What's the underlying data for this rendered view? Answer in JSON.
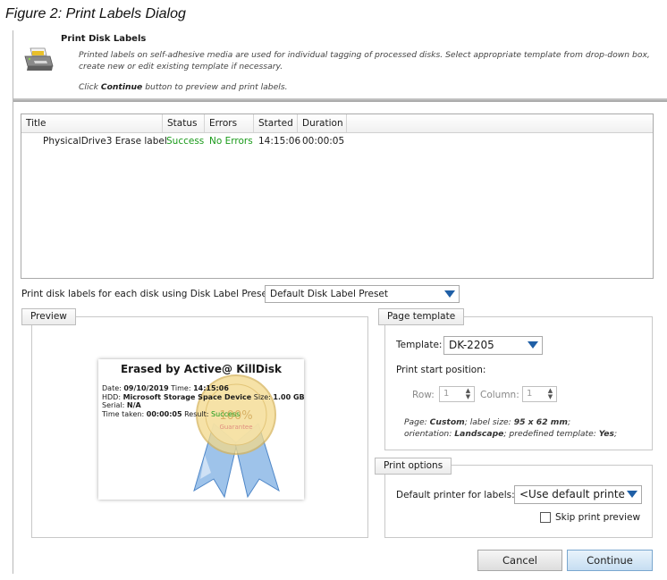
{
  "caption": "Figure 2: Print Labels Dialog",
  "header": {
    "title": "Print Disk Labels",
    "description": "Printed labels on self-adhesive media are used for individual tagging of processed disks. Select appropriate template from drop-down box, create new or edit existing template if necessary.",
    "click_prefix": "Click ",
    "click_bold": "Continue",
    "click_suffix": " button to preview and print labels.",
    "icon": "printer-icon"
  },
  "jobs_table": {
    "columns": [
      "Title",
      "Status",
      "Errors",
      "Started",
      "Duration"
    ],
    "rows": [
      {
        "title": "PhysicalDrive3 Erase label",
        "status": "Success",
        "errors": "No Errors",
        "started": "14:15:06",
        "duration": "00:00:05"
      }
    ],
    "success_color": "#1a9a1a"
  },
  "preset": {
    "label": "Print disk labels for each disk using Disk Label Preset:",
    "value": "Default Disk Label Preset"
  },
  "preview": {
    "tab_label": "Preview",
    "label": {
      "title": "Erased by Active@ KillDisk",
      "date_label": "Date: ",
      "date": "09/10/2019",
      "time_label": " Time: ",
      "time": "14:15:06",
      "hdd_label": "HDD: ",
      "hdd": "Microsoft Storage Space Device",
      "size_label": " Size: ",
      "size": "1.00 GB",
      "serial_label": "Serial: ",
      "serial": "N/A",
      "taken_label": "Time taken: ",
      "taken": "00:00:05",
      "result_label": " Result: ",
      "result": "Success",
      "seal_percent": "100%",
      "seal_word": "Guarantee"
    }
  },
  "page_template": {
    "tab_label": "Page template",
    "template_label": "Template:",
    "template_value": "DK-2205",
    "start_position_label": "Print start position:",
    "row_label": "Row:",
    "row_value": "1",
    "column_label": "Column:",
    "column_value": "1",
    "note_page": "Page: ",
    "note_page_value": "Custom",
    "note_size": "; label size: ",
    "note_size_value": "95 x 62 mm",
    "note_orient": "orientation: ",
    "note_orient_value": "Landscape",
    "note_predef": "; predefined template: ",
    "note_predef_value": "Yes"
  },
  "print_options": {
    "tab_label": "Print options",
    "printer_label": "Default printer for labels:",
    "printer_value": "<Use default printe",
    "skip_preview_label": "Skip print preview",
    "skip_preview_checked": false
  },
  "buttons": {
    "cancel": "Cancel",
    "continue": "Continue"
  }
}
